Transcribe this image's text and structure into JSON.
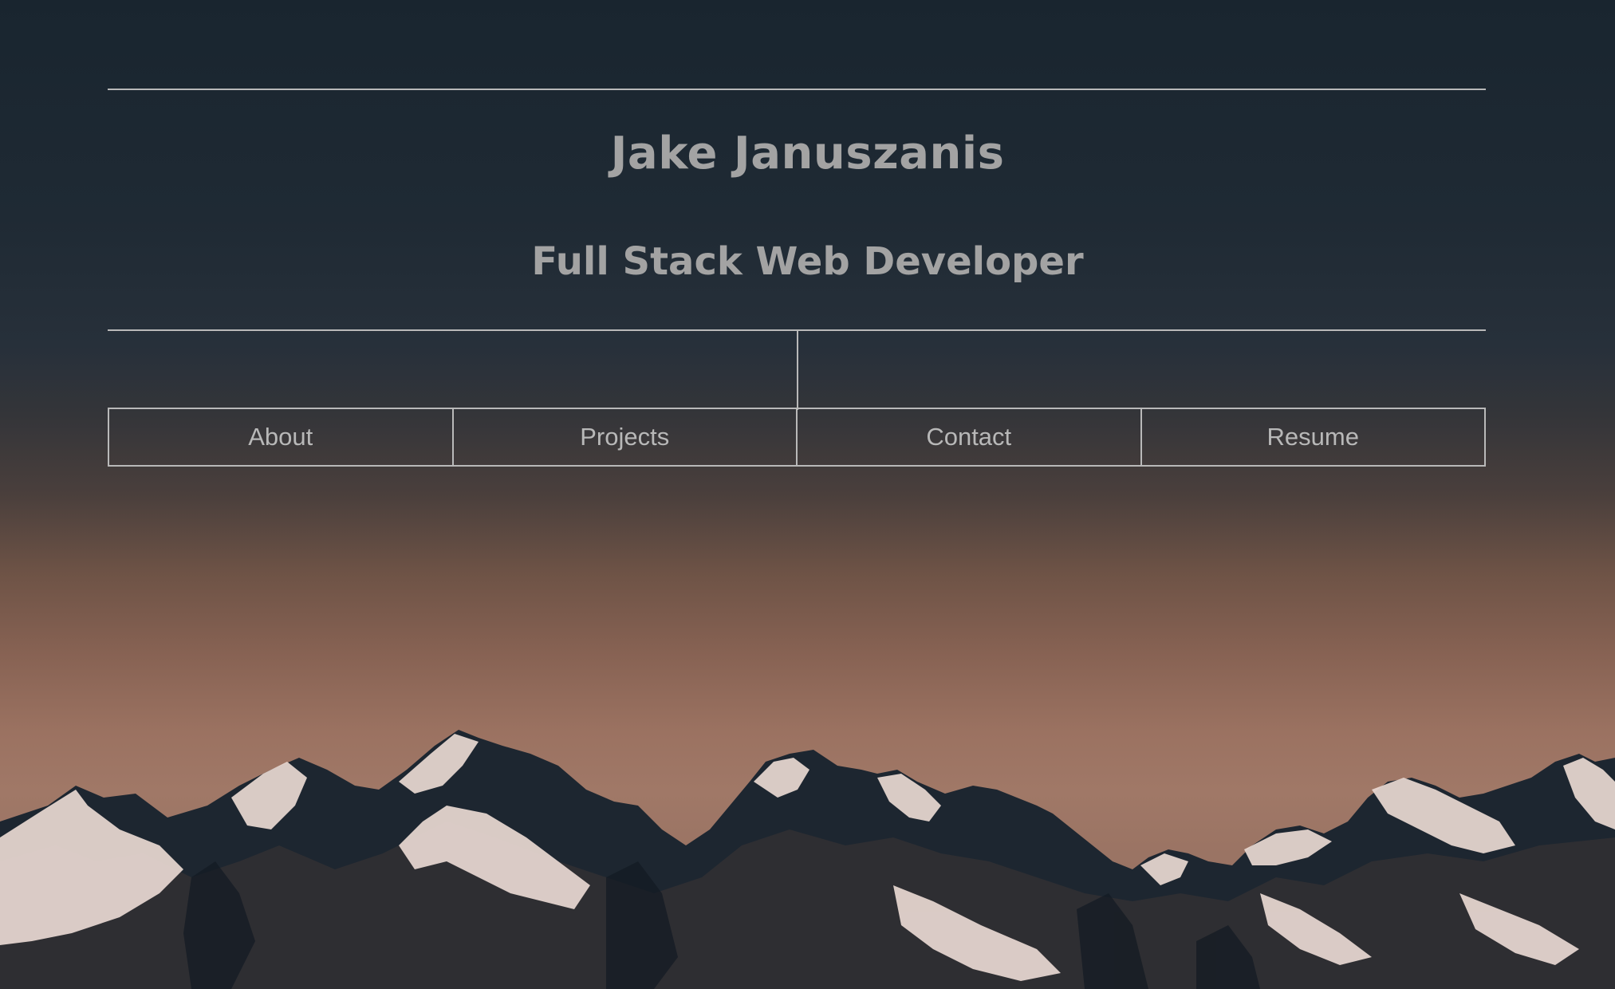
{
  "header": {
    "name": "Jake Januszanis",
    "role": "Full Stack Web Developer"
  },
  "nav": {
    "items": [
      {
        "label": "About"
      },
      {
        "label": "Projects"
      },
      {
        "label": "Contact"
      },
      {
        "label": "Resume"
      }
    ]
  },
  "colors": {
    "text": "#a3a3a3",
    "lines": "#b9b9b9",
    "sky_top": "#19252f",
    "sky_glow": "#a07867",
    "rock": "#1d2630",
    "snow": "#e9d9d2"
  }
}
